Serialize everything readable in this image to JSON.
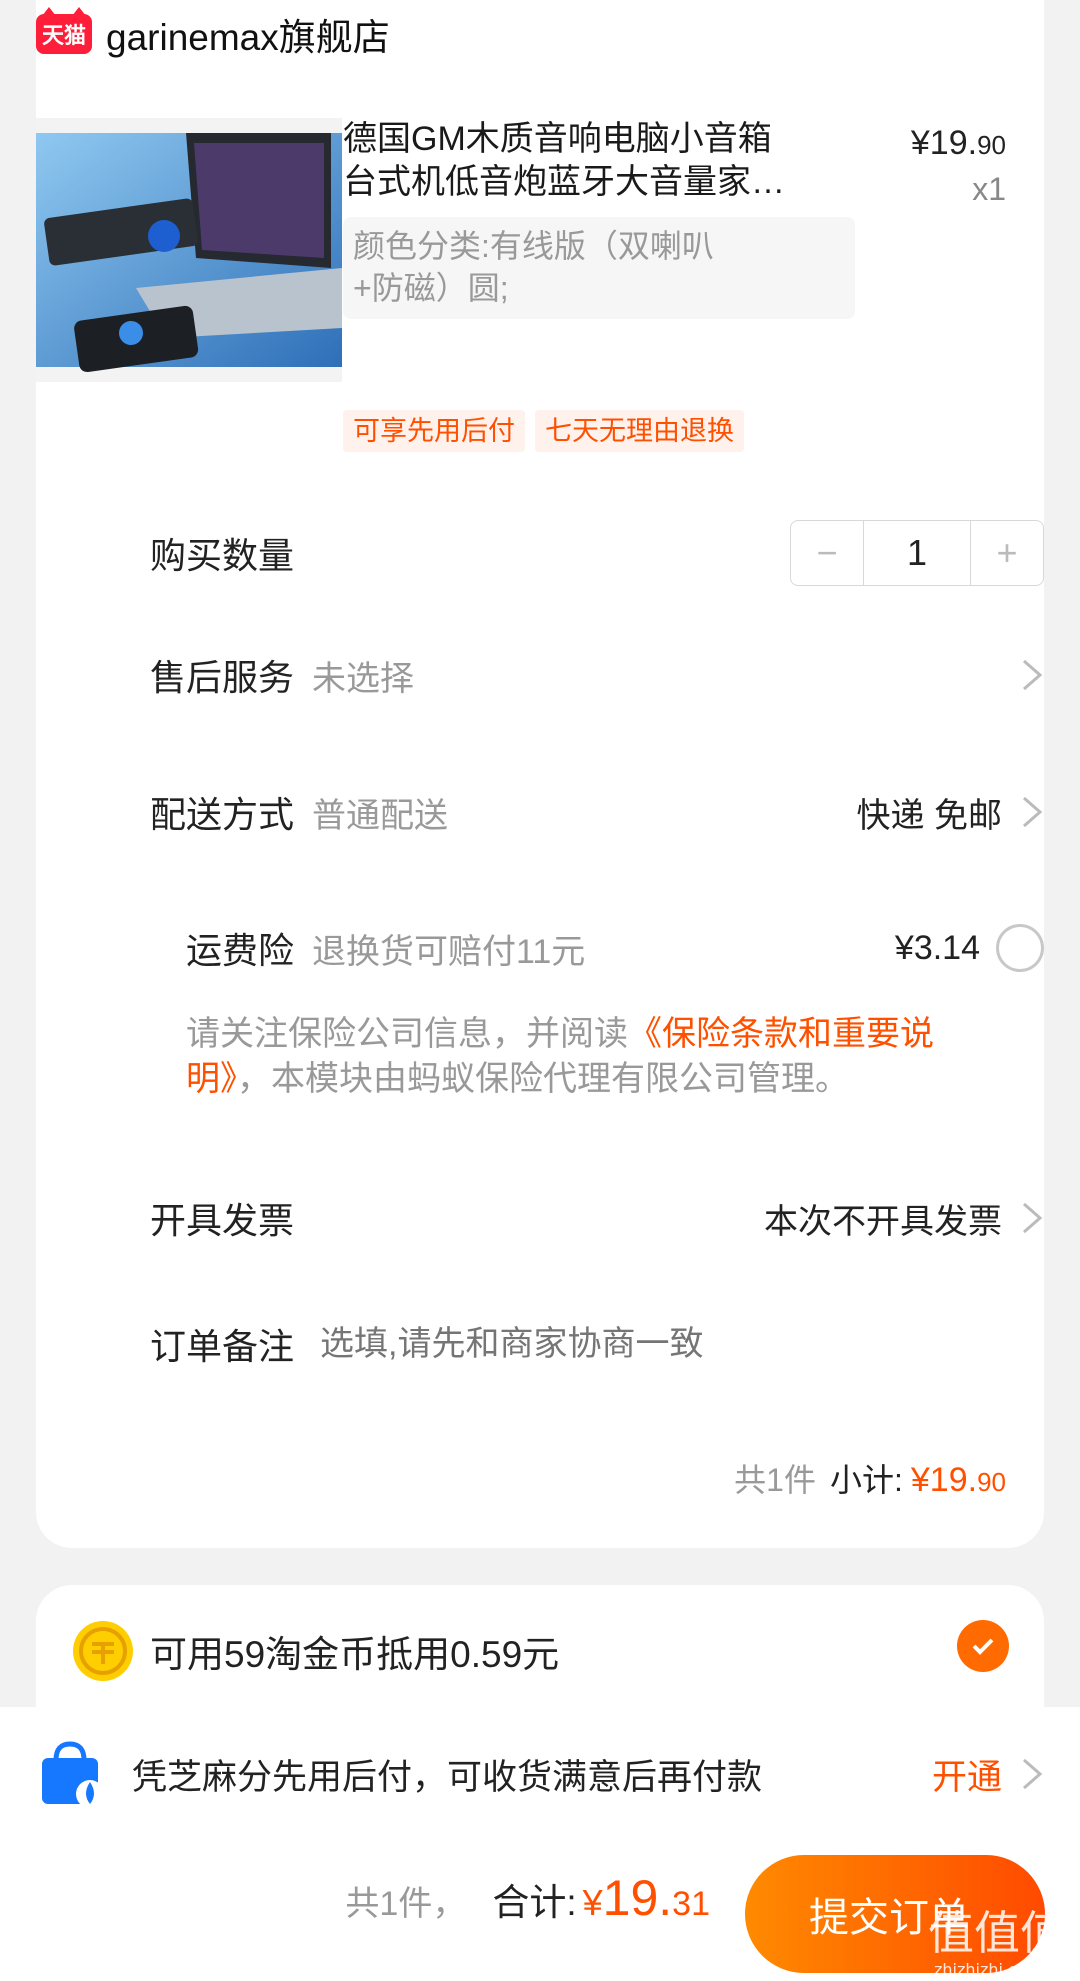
{
  "store": {
    "badge": "天猫",
    "name": "garinemax旗舰店"
  },
  "product": {
    "title_line1": "德国GM木质音响电脑小音箱",
    "title_line2": "台式机低音炮蓝牙大音量家…",
    "price_main": "¥19.",
    "price_cents": "90",
    "quantity_text": "x1",
    "sku_line1": "颜色分类:有线版（双喇叭",
    "sku_line2": "+防磁）圆;",
    "tags": [
      "可享先用后付",
      "七天无理由退换"
    ]
  },
  "rows": {
    "qty_label": "购买数量",
    "qty_value": "1",
    "qty_minus": "−",
    "qty_plus": "+",
    "aftersale_label": "售后服务",
    "aftersale_value": "未选择",
    "delivery_label": "配送方式",
    "delivery_sub": "普通配送",
    "delivery_value": "快递 免邮",
    "insurance_label": "运费险",
    "insurance_sub": "退换货可赔付11元",
    "insurance_price": "¥3.14",
    "invoice_label": "开具发票",
    "invoice_value": "本次不开具发票",
    "note_label": "订单备注",
    "note_placeholder": "选填,请先和商家协商一致"
  },
  "notice": {
    "text_before": "请关注保险公司信息，并阅读",
    "link": "《保险条款和重要说明》",
    "text_after": "，本模块由蚂蚁保险代理有限公司管理。"
  },
  "subtotal": {
    "count": "共1件",
    "label": "小计:",
    "amount_main": "¥19.",
    "amount_cents": "90"
  },
  "coins": {
    "text": "可用59淘金币抵用0.59元",
    "checked": true
  },
  "promo": {
    "text": "凭芝麻分先用后付，可收货满意后再付款",
    "action": "开通"
  },
  "footer": {
    "count": "共1件，",
    "total_label": "合计:",
    "currency": "¥",
    "total_main": "19.",
    "total_cents": "31",
    "submit_label": "提交订单"
  },
  "watermark": {
    "text": "值",
    "site": "zhizhizhi.com"
  },
  "colors": {
    "accent": "#ff5000",
    "tmall": "#ff1e39"
  }
}
